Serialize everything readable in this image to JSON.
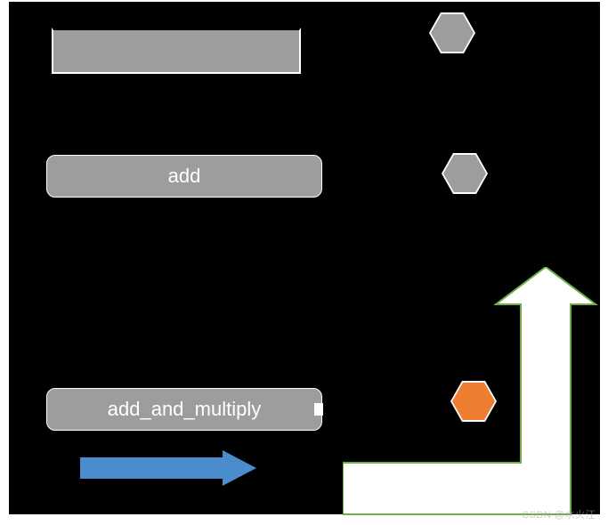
{
  "labels": {
    "add": "add",
    "add_and_multiply": "add_and_multiply"
  },
  "colors": {
    "grey": "#9d9d9d",
    "orange": "#ed7d31",
    "blue": "#4a8ccc",
    "green": "#70ad47",
    "black": "#000000",
    "white": "#ffffff"
  },
  "shapes": {
    "top_rect": {
      "type": "rectangle",
      "fill": "grey"
    },
    "hex_top": {
      "type": "hexagon",
      "fill": "grey"
    },
    "hex_mid": {
      "type": "hexagon",
      "fill": "grey"
    },
    "hex_bottom": {
      "type": "hexagon",
      "fill": "orange"
    },
    "blue_arrow": {
      "type": "arrow",
      "direction": "right",
      "fill": "blue"
    },
    "green_arrow": {
      "type": "L-arrow",
      "direction": "up-from-right",
      "outline": "green",
      "fill": "white"
    }
  },
  "watermark": "CSDN @水火汪"
}
